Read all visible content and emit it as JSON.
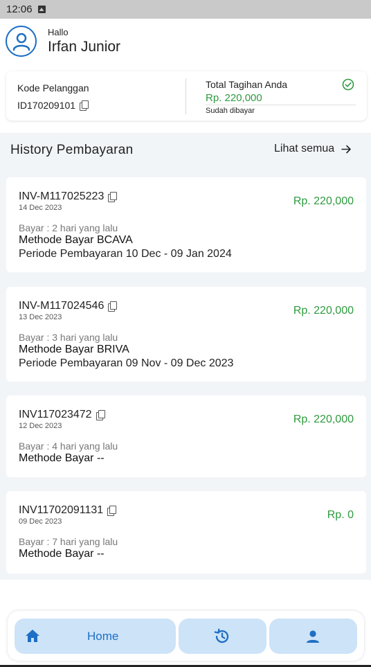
{
  "status_bar": {
    "time": "12:06"
  },
  "header": {
    "greeting": "Hallo",
    "user_name": "Irfan Junior"
  },
  "summary": {
    "customer_code_label": "Kode Pelanggan",
    "customer_code": "ID170209101",
    "total_label": "Total Tagihan Anda",
    "total_amount": "Rp. 220,000",
    "payment_status": "Sudah dibayar"
  },
  "history": {
    "title": "History Pembayaran",
    "see_all_label": "Lihat semua",
    "items": [
      {
        "invoice": "INV-M117025223",
        "date": "14 Dec 2023",
        "amount": "Rp. 220,000",
        "paid_ago": "Bayar : 2 hari yang lalu",
        "method": "Methode Bayar BCAVA",
        "period": "Periode Pembayaran 10 Dec - 09 Jan 2024"
      },
      {
        "invoice": "INV-M117024546",
        "date": "13 Dec 2023",
        "amount": "Rp. 220,000",
        "paid_ago": "Bayar : 3 hari yang lalu",
        "method": "Methode Bayar BRIVA",
        "period": "Periode Pembayaran 09 Nov - 09 Dec 2023"
      },
      {
        "invoice": "INV117023472",
        "date": "12 Dec 2023",
        "amount": "Rp. 220,000",
        "paid_ago": "Bayar : 4 hari yang lalu",
        "method": "Methode Bayar  --",
        "period": ""
      },
      {
        "invoice": "INV11702091131",
        "date": "09 Dec 2023",
        "amount": "Rp. 0",
        "paid_ago": "Bayar : 7 hari yang lalu",
        "method": "Methode Bayar  --",
        "period": ""
      }
    ]
  },
  "bottom_nav": {
    "home_label": "Home"
  },
  "colors": {
    "accent": "#1e6fc4",
    "success": "#2e9a3e",
    "nav_bg": "#cde3f8",
    "band_bg": "#f2f5f8"
  }
}
